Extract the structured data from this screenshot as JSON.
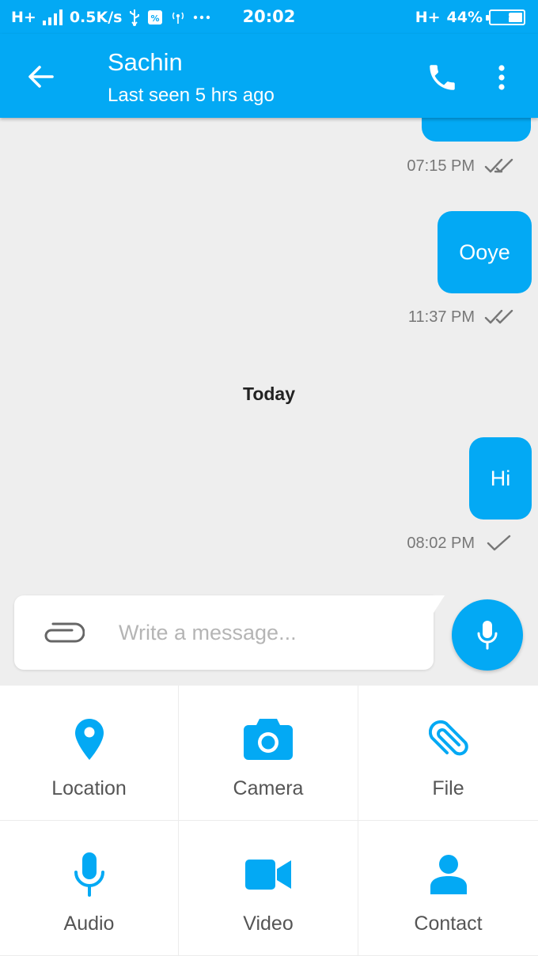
{
  "status_bar": {
    "network": "H+",
    "speed": "0.5K/s",
    "time": "20:02",
    "network_right": "H+",
    "battery": "44%",
    "battery_level": 0.44
  },
  "header": {
    "contact_name": "Sachin",
    "last_seen": "Last seen 5 hrs ago"
  },
  "messages": [
    {
      "text": "",
      "time": "07:15 PM",
      "status": "read"
    },
    {
      "text": "Ooye",
      "time": "11:37 PM",
      "status": "read"
    },
    {
      "text": "Hi",
      "time": "08:02 PM",
      "status": "sent"
    }
  ],
  "day_separator": "Today",
  "composer": {
    "placeholder": "Write a message..."
  },
  "attachments": [
    {
      "label": "Location",
      "icon": "location-pin-icon"
    },
    {
      "label": "Camera",
      "icon": "camera-icon"
    },
    {
      "label": "File",
      "icon": "paperclip-icon"
    },
    {
      "label": "Audio",
      "icon": "microphone-icon"
    },
    {
      "label": "Video",
      "icon": "video-camera-icon"
    },
    {
      "label": "Contact",
      "icon": "person-icon"
    }
  ],
  "colors": {
    "accent": "#03a9f4",
    "chat_background": "#eeeeee",
    "meta_text": "#777777"
  }
}
